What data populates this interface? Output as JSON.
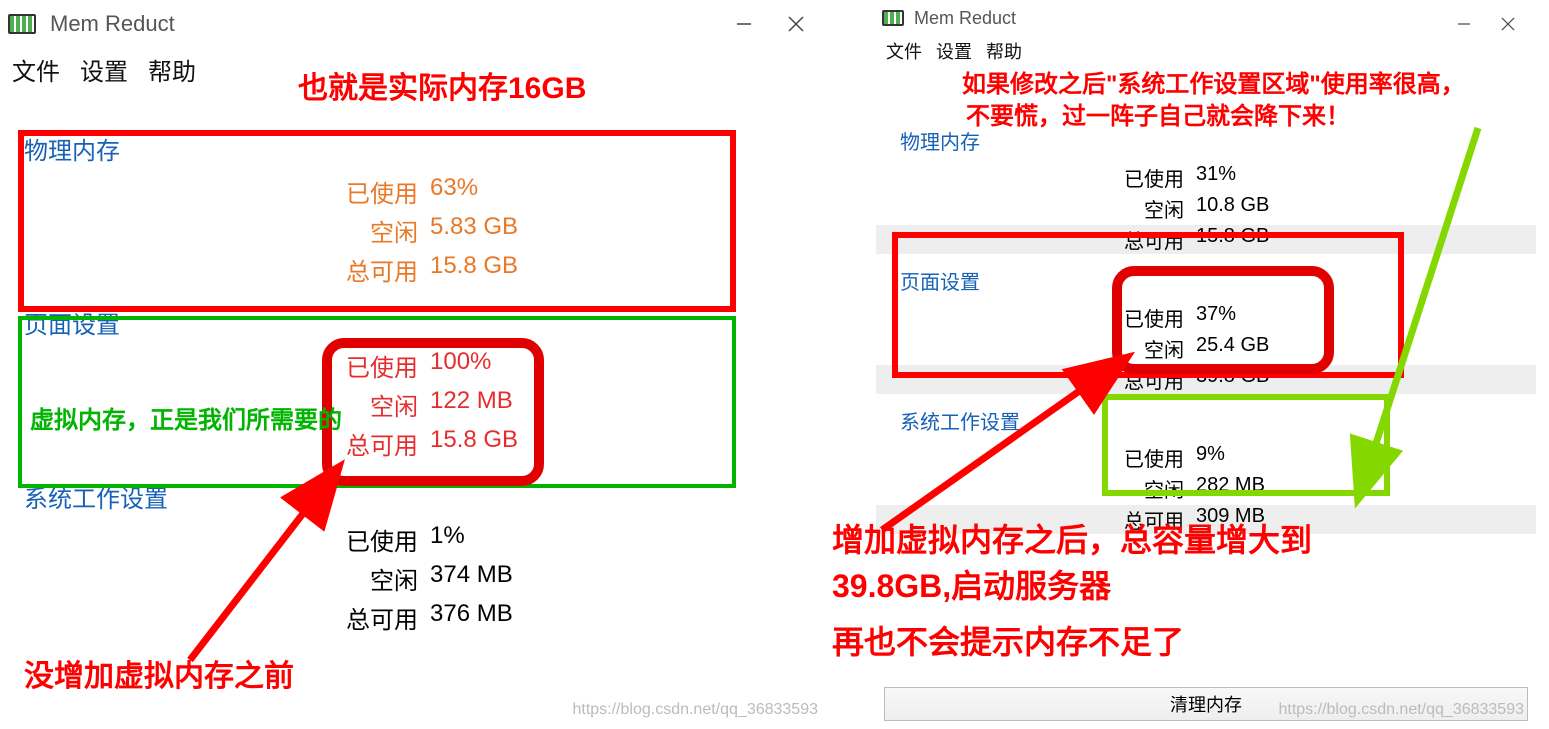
{
  "app": {
    "title": "Mem Reduct",
    "menu": {
      "file": "文件",
      "settings": "设置",
      "help": "帮助"
    }
  },
  "labels": {
    "used": "已使用",
    "free": "空闲",
    "total": "总可用",
    "clean": "清理内存"
  },
  "left": {
    "sections": {
      "physical": {
        "title": "物理内存",
        "used": "63%",
        "free": "5.83 GB",
        "total": "15.8 GB"
      },
      "page": {
        "title": "页面设置",
        "used": "100%",
        "free": "122 MB",
        "total": "15.8 GB"
      },
      "syswork": {
        "title": "系统工作设置",
        "used": "1%",
        "free": "374 MB",
        "total": "376 MB"
      }
    }
  },
  "right": {
    "sections": {
      "physical": {
        "title": "物理内存",
        "used": "31%",
        "free": "10.8 GB",
        "total": "15.8 GB"
      },
      "page": {
        "title": "页面设置",
        "used": "37%",
        "free": "25.4 GB",
        "total": "39.8 GB"
      },
      "syswork": {
        "title": "系统工作设置",
        "used": "9%",
        "free": "282 MB",
        "total": "309 MB"
      }
    }
  },
  "annotations": {
    "actual_16gb": "也就是实际内存16GB",
    "virtual_mem_needed": "虚拟内存，正是我们所需要的",
    "before_add": "没增加虚拟内存之前",
    "if_high_dont_panic_l1": "如果修改之后\"系统工作设置区域\"使用率很高，",
    "if_high_dont_panic_l2": "不要慌，过一阵子自己就会降下来！",
    "after_add_l1": "增加虚拟内存之后，总容量增大到",
    "after_add_l2": "39.8GB,启动服务器",
    "after_add_l3": "再也不会提示内存不足了"
  },
  "watermark": "https://blog.csdn.net/qq_36833593"
}
